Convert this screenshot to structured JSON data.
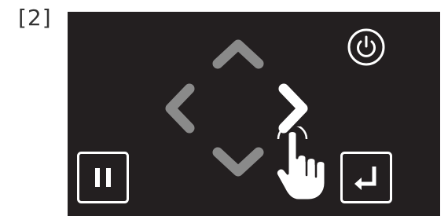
{
  "step_label": "[2]",
  "colors": {
    "panel_background": "#231f20",
    "arrow_inactive": "#8a8a8a",
    "arrow_active": "#ffffff",
    "button_border": "#ffffff",
    "label_text": "#333333"
  },
  "controls": {
    "up": {
      "icon": "chevron-up-icon",
      "state": "inactive"
    },
    "left": {
      "icon": "chevron-left-icon",
      "state": "inactive"
    },
    "right": {
      "icon": "chevron-right-icon",
      "state": "active"
    },
    "down": {
      "icon": "chevron-down-icon",
      "state": "inactive"
    },
    "power": {
      "icon": "power-icon"
    },
    "pause": {
      "icon": "pause-icon"
    },
    "enter": {
      "icon": "enter-return-icon"
    }
  },
  "pointer": {
    "icon": "hand-pointer-icon",
    "target": "right"
  }
}
